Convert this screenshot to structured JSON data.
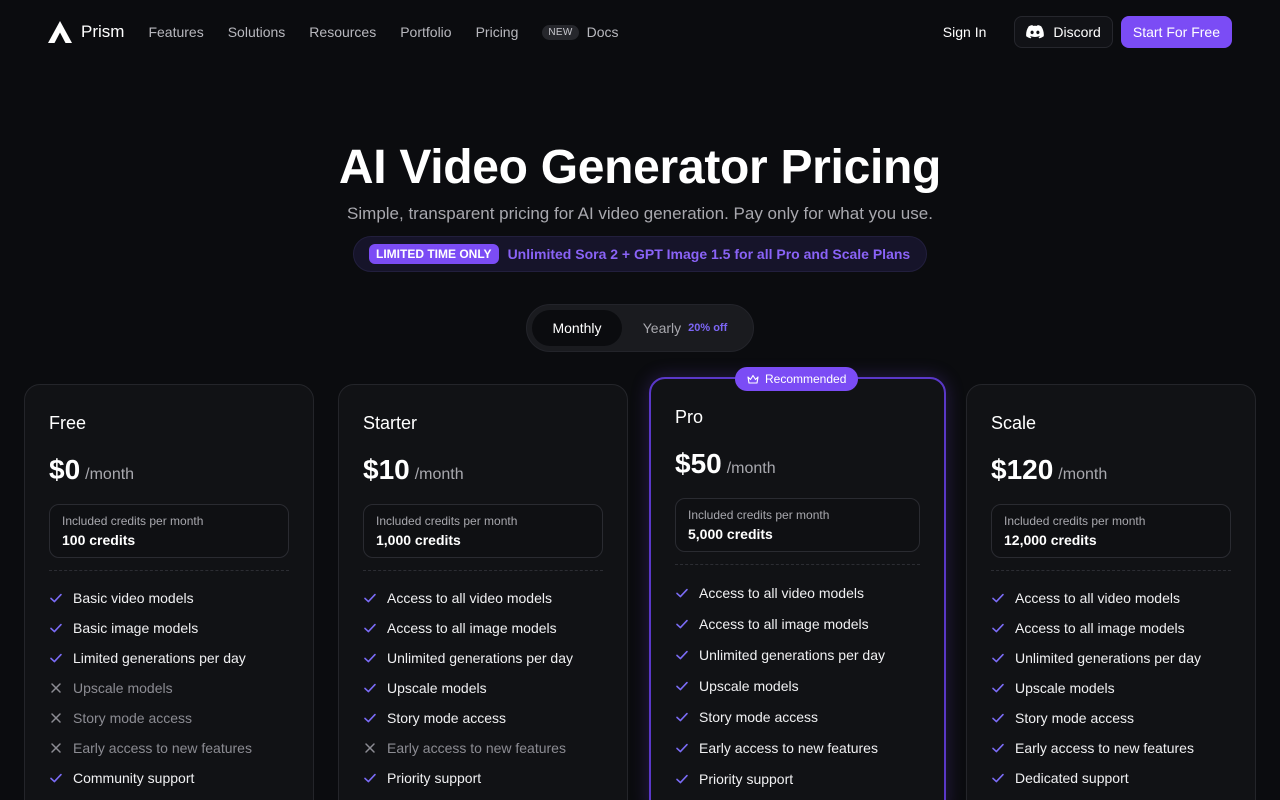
{
  "nav": {
    "brand": "Prism",
    "links": [
      "Features",
      "Solutions",
      "Resources",
      "Portfolio",
      "Pricing"
    ],
    "new_badge": "NEW",
    "docs": "Docs",
    "sign_in": "Sign In",
    "discord": "Discord",
    "start": "Start For Free"
  },
  "hero": {
    "title": "AI Video Generator Pricing",
    "subtitle": "Simple, transparent pricing for AI video generation. Pay only for what you use.",
    "promo_badge": "LIMITED TIME ONLY",
    "promo_text": "Unlimited Sora 2 + GPT Image 1.5 for all Pro and Scale Plans"
  },
  "billing_toggle": {
    "monthly": "Monthly",
    "yearly": "Yearly",
    "yearly_discount": "20% off",
    "selected": "Monthly"
  },
  "colors": {
    "accent": "#7b4cf5",
    "background": "#0b0c0f",
    "card": "#111215"
  },
  "plans": [
    {
      "name": "Free",
      "price": "$0",
      "period": "/month",
      "credits_label": "Included credits per month",
      "credits": "100 credits",
      "recommended": false,
      "features": [
        {
          "text": "Basic video models",
          "included": true
        },
        {
          "text": "Basic image models",
          "included": true
        },
        {
          "text": "Limited generations per day",
          "included": true
        },
        {
          "text": "Upscale models",
          "included": false
        },
        {
          "text": "Story mode access",
          "included": false
        },
        {
          "text": "Early access to new features",
          "included": false
        },
        {
          "text": "Community support",
          "included": true
        }
      ]
    },
    {
      "name": "Starter",
      "price": "$10",
      "period": "/month",
      "credits_label": "Included credits per month",
      "credits": "1,000 credits",
      "recommended": false,
      "features": [
        {
          "text": "Access to all video models",
          "included": true
        },
        {
          "text": "Access to all image models",
          "included": true
        },
        {
          "text": "Unlimited generations per day",
          "included": true
        },
        {
          "text": "Upscale models",
          "included": true
        },
        {
          "text": "Story mode access",
          "included": true
        },
        {
          "text": "Early access to new features",
          "included": false
        },
        {
          "text": "Priority support",
          "included": true
        }
      ]
    },
    {
      "name": "Pro",
      "price": "$50",
      "period": "/month",
      "credits_label": "Included credits per month",
      "credits": "5,000 credits",
      "recommended": true,
      "recommended_label": "Recommended",
      "features": [
        {
          "text": "Access to all video models",
          "included": true
        },
        {
          "text": "Access to all image models",
          "included": true
        },
        {
          "text": "Unlimited generations per day",
          "included": true
        },
        {
          "text": "Upscale models",
          "included": true
        },
        {
          "text": "Story mode access",
          "included": true
        },
        {
          "text": "Early access to new features",
          "included": true
        },
        {
          "text": "Priority support",
          "included": true
        }
      ]
    },
    {
      "name": "Scale",
      "price": "$120",
      "period": "/month",
      "credits_label": "Included credits per month",
      "credits": "12,000 credits",
      "recommended": false,
      "features": [
        {
          "text": "Access to all video models",
          "included": true
        },
        {
          "text": "Access to all image models",
          "included": true
        },
        {
          "text": "Unlimited generations per day",
          "included": true
        },
        {
          "text": "Upscale models",
          "included": true
        },
        {
          "text": "Story mode access",
          "included": true
        },
        {
          "text": "Early access to new features",
          "included": true
        },
        {
          "text": "Dedicated support",
          "included": true
        }
      ]
    }
  ]
}
